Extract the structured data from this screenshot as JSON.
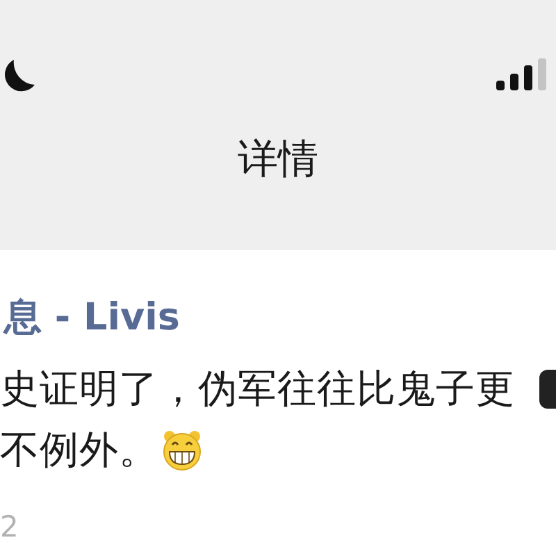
{
  "header": {
    "title": "详情"
  },
  "post": {
    "author": "息 - Livis",
    "lines": [
      {
        "text": "史证明了，伪军往往比鬼子更",
        "emoji": false
      },
      {
        "text": "不例外。",
        "emoji": true
      }
    ],
    "time": "2"
  }
}
